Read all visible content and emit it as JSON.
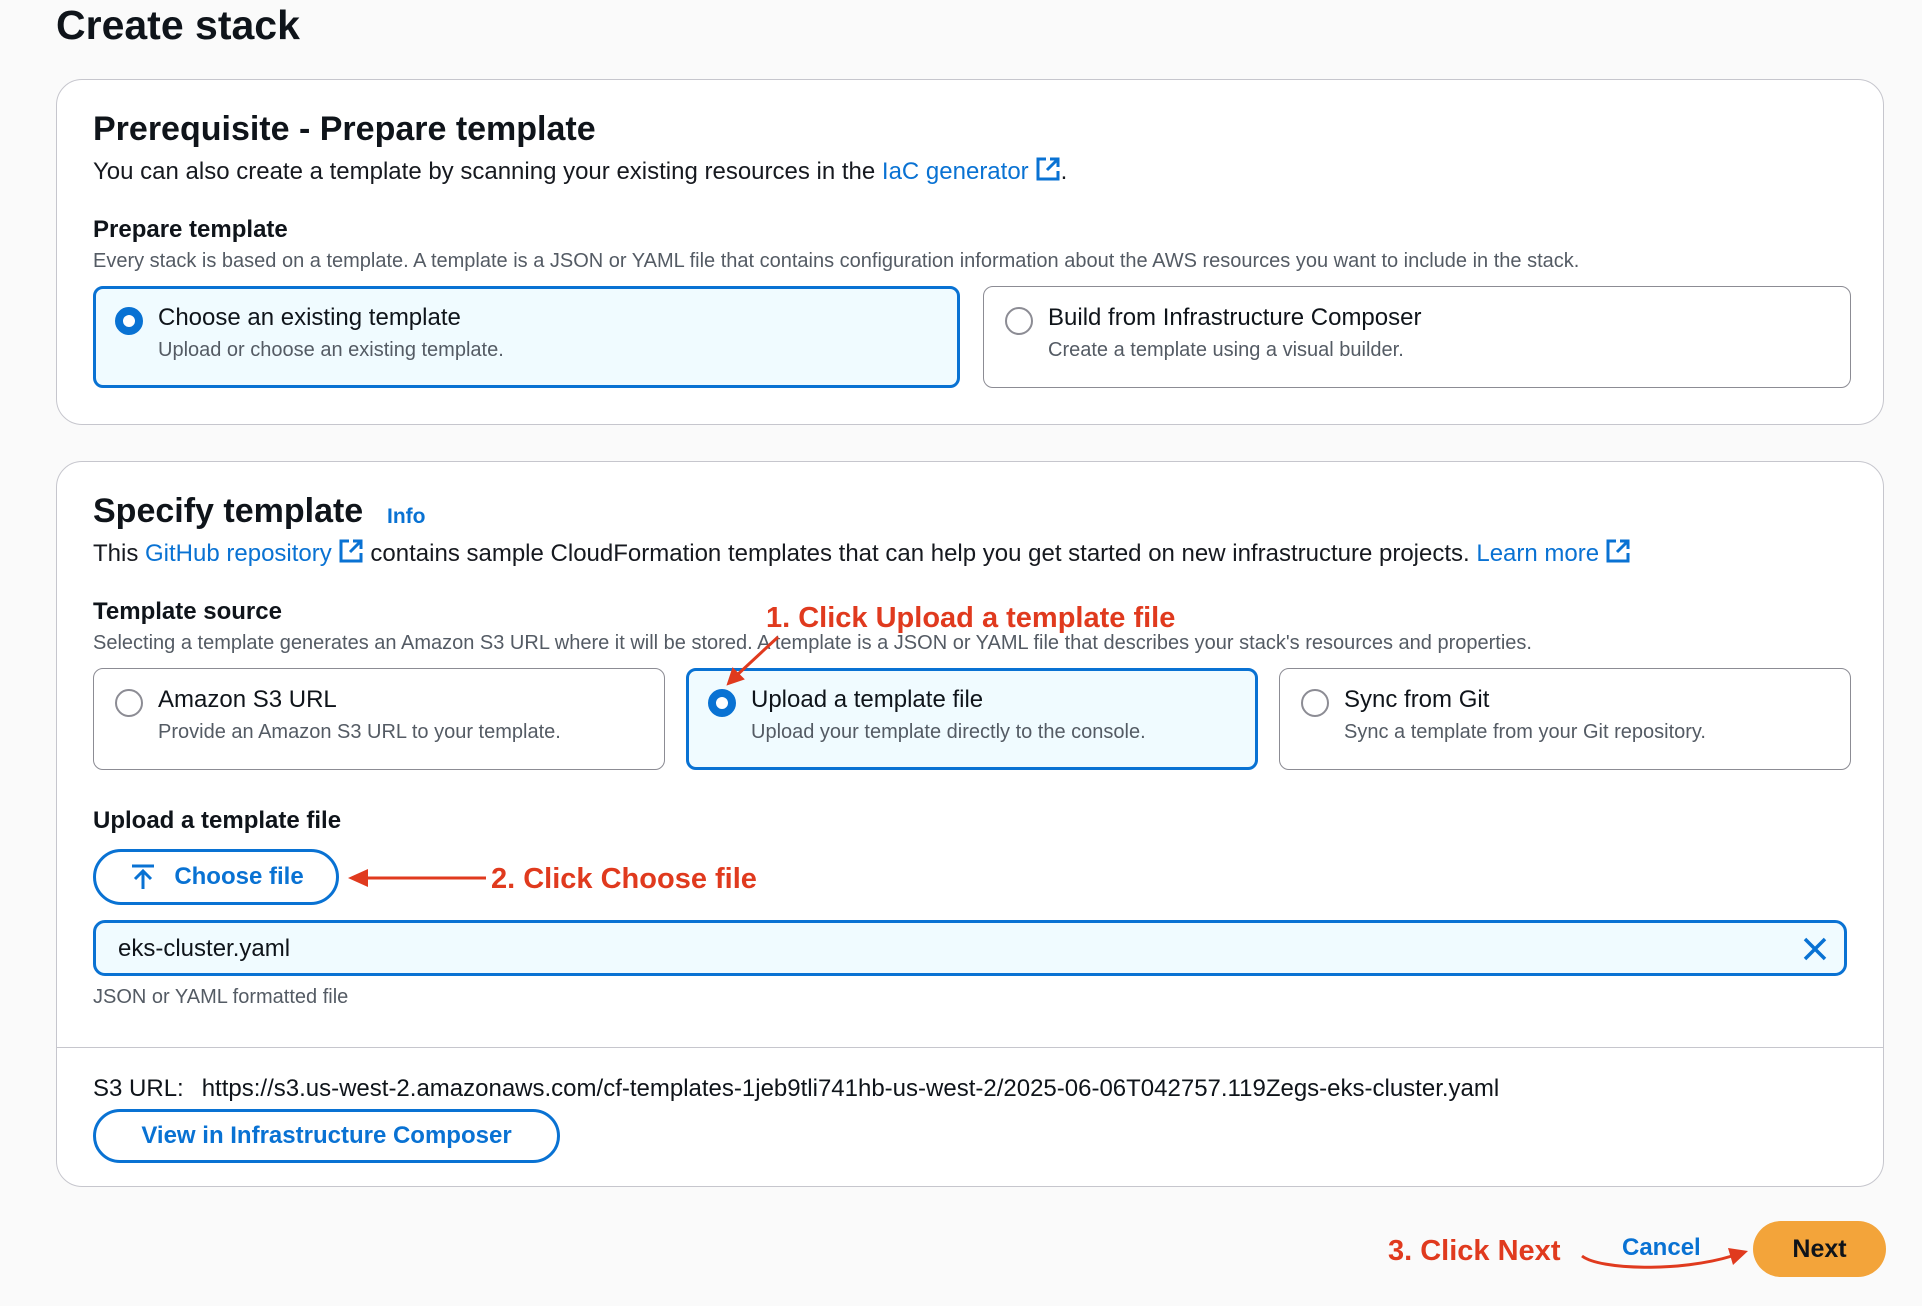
{
  "page": {
    "title": "Create stack"
  },
  "prerequisite": {
    "heading": "Prerequisite - Prepare template",
    "description_prefix": "You can also create a template by scanning your existing resources in the ",
    "description_link": "IaC generator",
    "description_suffix": ".",
    "field_label": "Prepare template",
    "field_description": "Every stack is based on a template. A template is a JSON or YAML file that contains configuration information about the AWS resources you want to include in the stack.",
    "options": [
      {
        "title": "Choose an existing template",
        "subtitle": "Upload or choose an existing template.",
        "selected": true
      },
      {
        "title": "Build from Infrastructure Composer",
        "subtitle": "Create a template using a visual builder.",
        "selected": false
      }
    ]
  },
  "specify": {
    "heading": "Specify template",
    "info_link": "Info",
    "description_prefix": "This ",
    "github_link": "GitHub repository",
    "description_middle": " contains sample CloudFormation templates that can help you get started on new infrastructure projects. ",
    "learn_more_link": "Learn more",
    "source_label": "Template source",
    "source_description": "Selecting a template generates an Amazon S3 URL where it will be stored. A template is a JSON or YAML file that describes your stack's resources and properties.",
    "options": [
      {
        "title": "Amazon S3 URL",
        "subtitle": "Provide an Amazon S3 URL to your template.",
        "selected": false
      },
      {
        "title": "Upload a template file",
        "subtitle": "Upload your template directly to the console.",
        "selected": true
      },
      {
        "title": "Sync from Git",
        "subtitle": "Sync a template from your Git repository.",
        "selected": false
      }
    ],
    "upload_label": "Upload a template file",
    "choose_file_button": "Choose file",
    "file_value": "eks-cluster.yaml",
    "file_hint": "JSON or YAML formatted file",
    "s3_label": "S3 URL:",
    "s3_url": "https://s3.us-west-2.amazonaws.com/cf-templates-1jeb9tli741hb-us-west-2/2025-06-06T042757.119Zegs-eks-cluster.yaml",
    "view_composer_button": "View in Infrastructure Composer"
  },
  "footer": {
    "cancel_label": "Cancel",
    "next_label": "Next"
  },
  "annotations": {
    "step1": "1. Click Upload a template file",
    "step2": "2. Click Choose file",
    "step3": "3. Click  Next"
  },
  "colors": {
    "accent": "#0972d3",
    "annotation": "#e03a1e",
    "primary_button": "#f3a43a"
  }
}
